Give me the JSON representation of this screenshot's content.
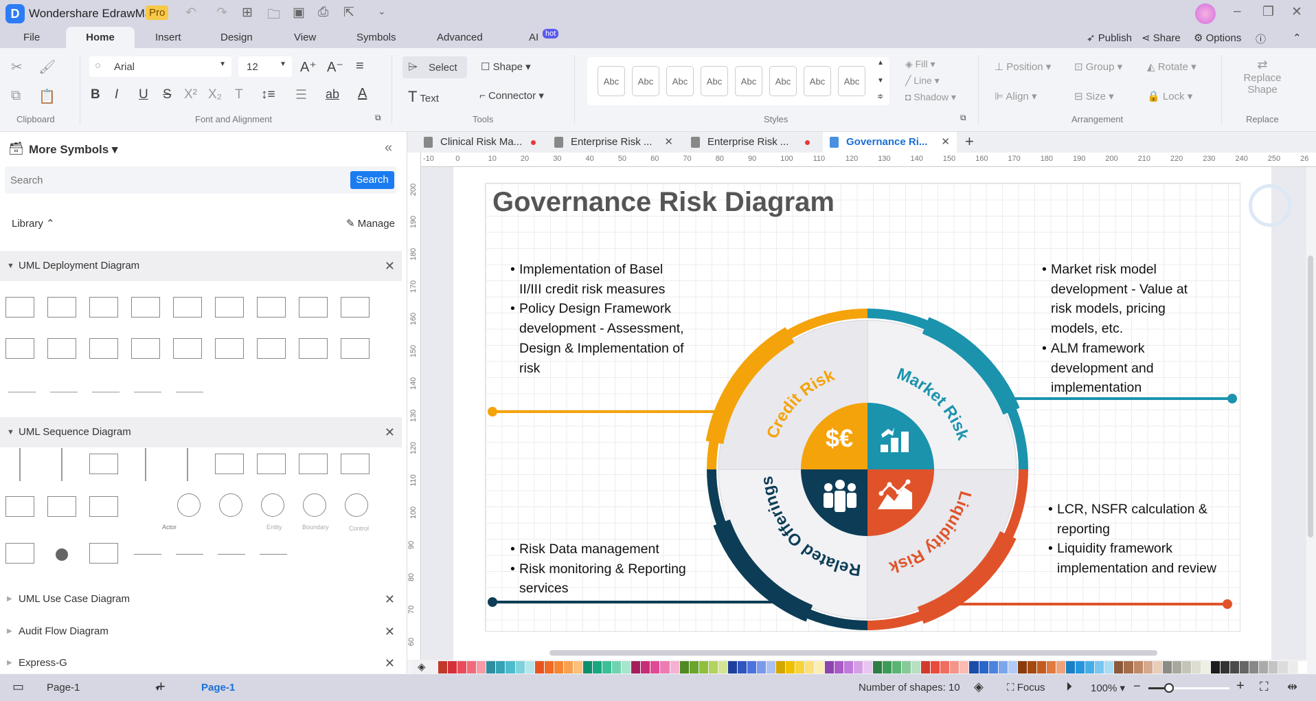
{
  "app": {
    "title": "Wondershare EdrawMax",
    "badge": "Pro"
  },
  "menu": {
    "items": [
      "File",
      "Home",
      "Insert",
      "Design",
      "View",
      "Symbols",
      "Advanced",
      "AI"
    ],
    "ai_badge": "hot",
    "right": {
      "publish": "Publish",
      "share": "Share",
      "options": "Options"
    }
  },
  "ribbon": {
    "font": "Arial",
    "size": "12",
    "select": "Select",
    "shape": "Shape",
    "text": "Text",
    "connector": "Connector",
    "styles": [
      "Abc",
      "Abc",
      "Abc",
      "Abc",
      "Abc",
      "Abc",
      "Abc",
      "Abc"
    ],
    "fill": "Fill",
    "line": "Line",
    "shadow": "Shadow",
    "position": "Position",
    "group": "Group",
    "rotate": "Rotate",
    "align": "Align",
    "size_btn": "Size",
    "lock": "Lock",
    "replace_shape": [
      "Replace",
      "Shape"
    ],
    "groups": {
      "clipboard": "Clipboard",
      "font": "Font and Alignment",
      "tools": "Tools",
      "styles": "Styles",
      "arrangement": "Arrangement",
      "replace": "Replace"
    }
  },
  "left": {
    "title": "More Symbols",
    "search_placeholder": "Search",
    "search_button": "Search",
    "library": "Library",
    "manage": "Manage",
    "libraries": [
      {
        "name": "UML Deployment Diagram",
        "expanded": true
      },
      {
        "name": "UML Sequence Diagram",
        "expanded": true
      },
      {
        "name": "UML Use Case Diagram",
        "expanded": false
      },
      {
        "name": "Audit Flow Diagram",
        "expanded": false
      },
      {
        "name": "Express-G",
        "expanded": false
      }
    ],
    "sequence_labels": [
      "Actor",
      "Entity",
      "Boundary",
      "Control"
    ]
  },
  "tabs": [
    {
      "label": "Clinical Risk Ma...",
      "state": "unsaved"
    },
    {
      "label": "Enterprise Risk ...",
      "state": "close"
    },
    {
      "label": "Enterprise Risk ...",
      "state": "unsaved"
    },
    {
      "label": "Governance Ri...",
      "state": "active"
    }
  ],
  "ruler": {
    "h": [
      "-10",
      "0",
      "10",
      "20",
      "30",
      "40",
      "50",
      "60",
      "70",
      "80",
      "90",
      "100",
      "110",
      "120",
      "130",
      "140",
      "150",
      "160",
      "170",
      "180",
      "190",
      "200",
      "210",
      "220",
      "230",
      "240",
      "250",
      "26"
    ],
    "v": [
      "200",
      "190",
      "180",
      "170",
      "160",
      "150",
      "140",
      "130",
      "120",
      "110",
      "100",
      "90",
      "80",
      "70",
      "60"
    ]
  },
  "diagram": {
    "title": "Governance Risk Diagram",
    "colors": {
      "credit": "#f5a30a",
      "market": "#1b93ad",
      "liquidity": "#e0532a",
      "offerings": "#0d3d56"
    },
    "segments": {
      "credit": "Credit Risk",
      "market": "Market Risk",
      "liquidity": "Liquidity Risk",
      "offerings": "Related Offerings"
    },
    "center_icons": {
      "credit": "$€",
      "market": "bar-chart-icon",
      "offerings": "people-icon",
      "liquidity": "area-chart-icon"
    },
    "notes": {
      "credit": [
        "Implementation of Basel II/III credit risk measures",
        "Policy Design Framework development - Assessment, Design & Implementation of risk"
      ],
      "market": [
        "Market risk model development - Value at risk models, pricing models, etc.",
        "ALM framework development and implementation"
      ],
      "offerings": [
        "Risk Data management",
        "Risk monitoring & Reporting services"
      ],
      "liquidity": [
        "LCR, NSFR calculation & reporting",
        "Liquidity framework implementation and review"
      ]
    }
  },
  "palette": [
    "#c0392b",
    "#d6313b",
    "#e84c5a",
    "#ef6b7a",
    "#f59aa6",
    "#2d8ea0",
    "#33a3b5",
    "#4bbccc",
    "#7fd1dc",
    "#b4e6ec",
    "#e8541e",
    "#f06a23",
    "#f58535",
    "#f8a04d",
    "#fbc07b",
    "#0e8f6b",
    "#18a77e",
    "#3cbf96",
    "#6fd3b2",
    "#a6e6cf",
    "#a51e5c",
    "#c62d76",
    "#e04994",
    "#ec7bb3",
    "#f5b0d2",
    "#4f8a22",
    "#6aa52b",
    "#8fbf3c",
    "#b2d35e",
    "#d3e594",
    "#1f3f9c",
    "#2f55c0",
    "#4b73db",
    "#7a99e8",
    "#adc0f2",
    "#d4a600",
    "#f0c000",
    "#f7d33a",
    "#fae07a",
    "#fcedb3",
    "#8e44ad",
    "#a95bc7",
    "#c07ad9",
    "#d59fe6",
    "#e8c6f1",
    "#2e7d46",
    "#3d9b57",
    "#5bb474",
    "#86ca98",
    "#b6e0c1",
    "#d33a2c",
    "#ea4a3b",
    "#f06d5f",
    "#f59489",
    "#f9bbb3",
    "#1a4ea8",
    "#2a66c9",
    "#4b83e0",
    "#7ca6ec",
    "#b1cbf5",
    "#8a3b0c",
    "#a6490f",
    "#c45c1f",
    "#e07a3e",
    "#f0a27a",
    "#1b7fc4",
    "#2596de",
    "#44aee9",
    "#77c7f0",
    "#abdcf6",
    "#8b5a3c",
    "#a66d4b",
    "#c08866",
    "#d6a88c",
    "#e9cdb9",
    "#8c8c84",
    "#a8a89e",
    "#c4c4b8",
    "#ddddd1",
    "#efefe3",
    "#1d1d1d",
    "#333333",
    "#4a4a4a",
    "#666666",
    "#888888",
    "#aaaaaa",
    "#c4c4c4",
    "#dcdcdc",
    "#ececec",
    "#ffffff"
  ],
  "status": {
    "page_select": "Page-1",
    "page_tab": "Page-1",
    "shapes": "Number of shapes: 10",
    "focus": "Focus",
    "zoom": "100%",
    "zoom_level": 1.0
  }
}
